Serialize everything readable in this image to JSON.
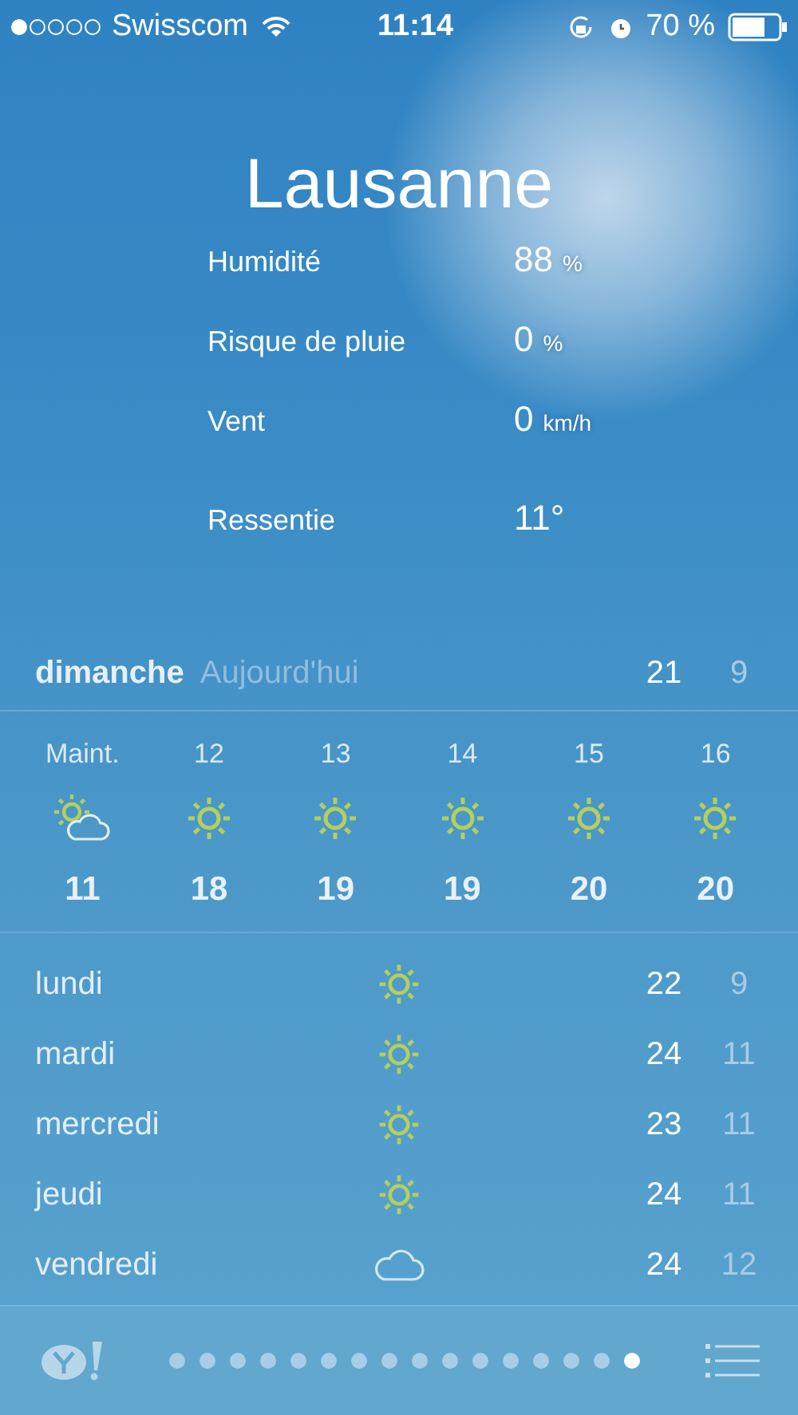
{
  "status_bar": {
    "carrier": "Swisscom",
    "time": "11:14",
    "battery": "70 %"
  },
  "city": "Lausanne",
  "details": [
    {
      "label": "Humidité",
      "value": "88",
      "unit": "%"
    },
    {
      "label": "Risque de pluie",
      "value": "0",
      "unit": "%"
    },
    {
      "label": "Vent",
      "value": "0",
      "unit": "km/h"
    },
    {
      "label": "Ressentie",
      "value": "11°"
    }
  ],
  "today": {
    "day": "dimanche",
    "label": "Aujourd'hui",
    "high": "21",
    "low": "9"
  },
  "hourly": [
    {
      "time": "Maint.",
      "kind": "partly-cloudy",
      "temp": "11"
    },
    {
      "time": "12",
      "kind": "sunny",
      "temp": "18"
    },
    {
      "time": "13",
      "kind": "sunny",
      "temp": "19"
    },
    {
      "time": "14",
      "kind": "sunny",
      "temp": "19"
    },
    {
      "time": "15",
      "kind": "sunny",
      "temp": "20"
    },
    {
      "time": "16",
      "kind": "sunny",
      "temp": "20"
    }
  ],
  "daily": [
    {
      "day": "lundi",
      "kind": "sunny",
      "high": "22",
      "low": "9"
    },
    {
      "day": "mardi",
      "kind": "sunny",
      "high": "24",
      "low": "11"
    },
    {
      "day": "mercredi",
      "kind": "sunny",
      "high": "23",
      "low": "11"
    },
    {
      "day": "jeudi",
      "kind": "sunny",
      "high": "24",
      "low": "11"
    },
    {
      "day": "vendredi",
      "kind": "cloudy",
      "high": "24",
      "low": "12"
    }
  ],
  "page_dots": [
    {
      "selected": false
    },
    {
      "selected": false
    },
    {
      "selected": false
    },
    {
      "selected": false
    },
    {
      "selected": false
    },
    {
      "selected": false
    },
    {
      "selected": false
    },
    {
      "selected": false
    },
    {
      "selected": false
    },
    {
      "selected": false
    },
    {
      "selected": false
    },
    {
      "selected": false
    },
    {
      "selected": false
    },
    {
      "selected": false
    },
    {
      "selected": false
    },
    {
      "selected": true
    }
  ]
}
